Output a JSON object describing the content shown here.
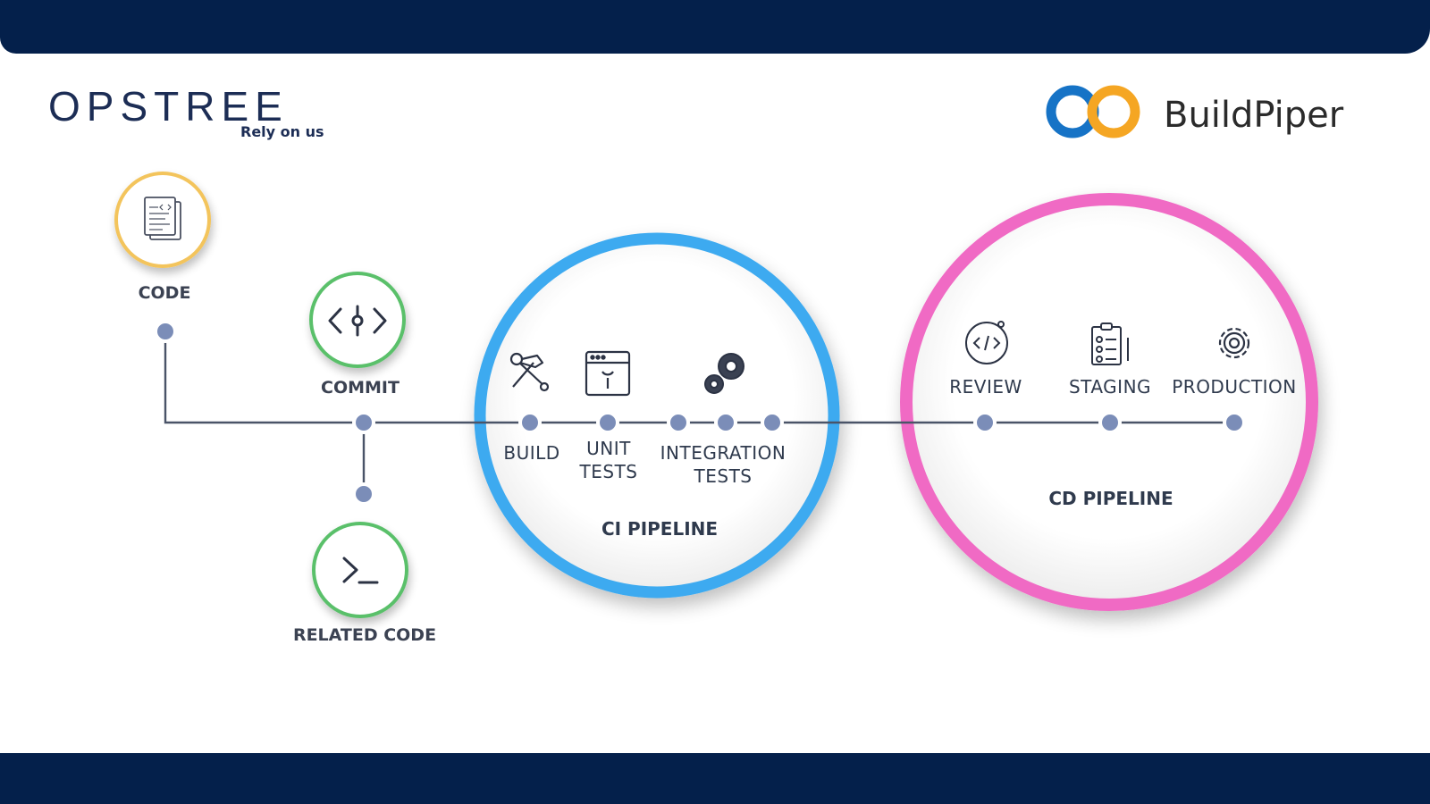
{
  "branding": {
    "opstree_name": "OPSTREE",
    "opstree_tagline": "Rely on us",
    "buildpiper_name": "BuildPiper"
  },
  "source_stages": {
    "code": "CODE",
    "commit": "COMMIT",
    "related_code": "RELATED CODE"
  },
  "ci_pipeline": {
    "title": "CI PIPELINE",
    "build": "BUILD",
    "unit_tests_line1": "UNIT",
    "unit_tests_line2": "TESTS",
    "integration_tests_line1": "INTEGRATION",
    "integration_tests_line2": "TESTS"
  },
  "cd_pipeline": {
    "title": "CD PIPELINE",
    "review": "REVIEW",
    "staging": "STAGING",
    "production": "PRODUCTION"
  },
  "colors": {
    "navy": "#04204b",
    "ci_ring": "#3daaf0",
    "cd_ring": "#f06ac4",
    "node": "#7b8db8",
    "code_ring": "#f3c45c",
    "commit_ring": "#5ac06b",
    "bp_blue": "#1673c6",
    "bp_orange": "#f5a623"
  },
  "icons": [
    "code-file-icon",
    "commit-icon",
    "terminal-icon",
    "hammer-wrench-icon",
    "browser-wrench-icon",
    "gears-icon",
    "code-review-icon",
    "clipboard-checklist-icon",
    "gear-icon"
  ]
}
